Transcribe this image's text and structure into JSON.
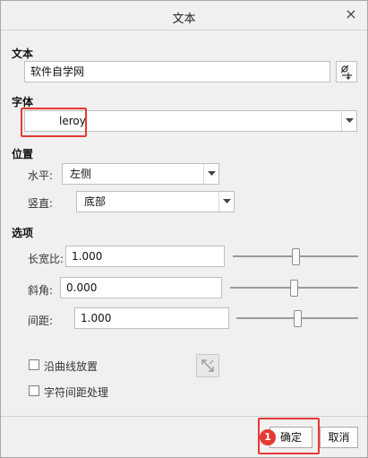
{
  "dialog": {
    "title": "文本",
    "close_glyph": "×"
  },
  "text_section": {
    "heading": "文本",
    "value": "软件自学网"
  },
  "font_section": {
    "heading": "字体",
    "selected": "leroy"
  },
  "position_section": {
    "heading": "位置",
    "horizontal_label": "水平:",
    "horizontal_value": "左侧",
    "vertical_label": "竖直:",
    "vertical_value": "底部"
  },
  "options_section": {
    "heading": "选项",
    "aspect_label": "长宽比:",
    "aspect_value": "1.000",
    "aspect_slider": 0.5,
    "slant_label": "斜角:",
    "slant_value": "0.000",
    "slant_slider": 0.5,
    "spacing_label": "间距:",
    "spacing_value": "1.000",
    "spacing_slider": 0.5,
    "along_curve_label": "沿曲线放置",
    "char_spacing_label": "字符间距处理"
  },
  "footer": {
    "ok_label": "确定",
    "cancel_label": "取消",
    "badge_number": "1"
  },
  "colors": {
    "highlight": "#e53935",
    "background": "#f0f0f0"
  }
}
